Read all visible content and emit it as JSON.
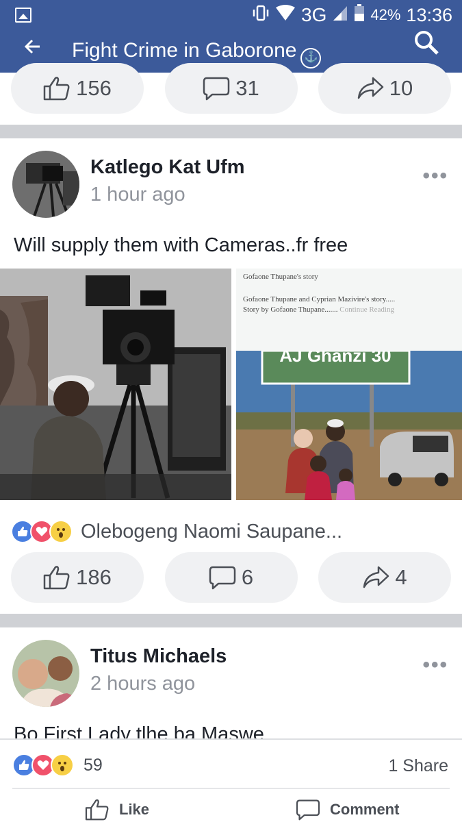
{
  "status_bar": {
    "network": "3G",
    "battery": "42%",
    "time": "13:36",
    "icons": [
      "image-icon",
      "vibrate-icon",
      "wifi-icon",
      "signal-icon",
      "battery-icon"
    ]
  },
  "header": {
    "back_icon": "arrow-left-icon",
    "title": "Fight Crime in Gaborone",
    "globe_icon": "globe-icon",
    "search_icon": "search-icon"
  },
  "post_prev": {
    "likes": "156",
    "comments": "31",
    "shares": "10"
  },
  "post_main": {
    "author": "Katlego Kat Ufm",
    "time": "1 hour ago",
    "more": "•••",
    "text": "Will supply them with Cameras..fr free",
    "story": {
      "title": "Gofaone Thupane's story",
      "text": "Gofaone Thupane and Cyprian Mazivire's story.....",
      "byline": "Story by Gofaone Thupane.......",
      "more": "Continue Reading"
    },
    "sign_text": "AJ Ghanzi 30",
    "reaction_names": "Olebogeng Naomi Saupane...",
    "likes": "186",
    "comments": "6",
    "shares": "4"
  },
  "post_next": {
    "author": "Titus Michaels",
    "time": "2 hours ago",
    "more": "•••",
    "text": "Bo First Lady tlhe ba Maswe"
  },
  "bottom_bar": {
    "reaction_count": "59",
    "share_count": "1 Share",
    "like_label": "Like",
    "comment_label": "Comment"
  },
  "colors": {
    "brand": "#3c5a9a",
    "like": "#4a7fe0",
    "love": "#f0516a",
    "wow": "#f7cf45"
  }
}
